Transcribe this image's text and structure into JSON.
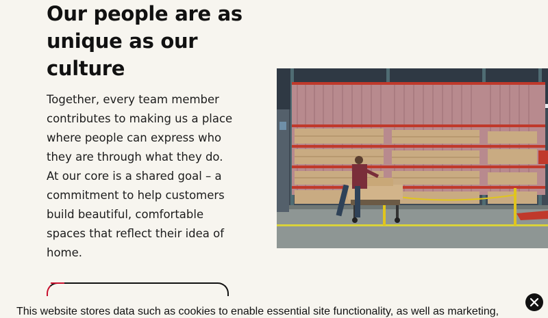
{
  "hero": {
    "headline": "Our people are as unique as our culture",
    "body": "Together, every team member contributes to making us a place where people can express who they are through what they do. At our core is a shared goal – a commitment to help customers build beautiful, comfortable spaces that reflect their idea of home."
  },
  "photo": {
    "icon": "warehouse-worker-photo"
  },
  "cookie_banner": {
    "text": "This website stores data such as cookies to enable essential site functionality, as well as marketing,",
    "close_icon": "close-icon"
  },
  "colors": {
    "background": "#f7f5ef",
    "accent": "#c8102e",
    "text": "#111111"
  }
}
